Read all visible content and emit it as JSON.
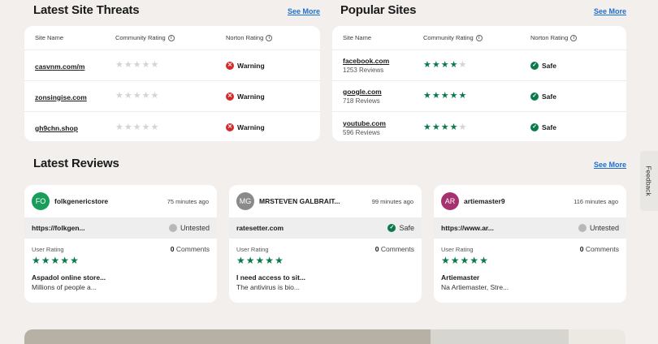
{
  "threats": {
    "title": "Latest Site Threats",
    "see_more": "See More",
    "headers": {
      "site": "Site Name",
      "community": "Community Rating",
      "norton": "Norton Rating"
    },
    "rows": [
      {
        "site": "casvnm.com/m",
        "stars": 0,
        "status": "Warning"
      },
      {
        "site": "zonsingise.com",
        "stars": 0,
        "status": "Warning"
      },
      {
        "site": "gh9chn.shop",
        "stars": 0,
        "status": "Warning"
      }
    ]
  },
  "popular": {
    "title": "Popular Sites",
    "see_more": "See More",
    "headers": {
      "site": "Site Name",
      "community": "Community Rating",
      "norton": "Norton Rating"
    },
    "rows": [
      {
        "site": "facebook.com",
        "reviews": "1253 Reviews",
        "stars": 4,
        "status": "Safe"
      },
      {
        "site": "google.com",
        "reviews": "718 Reviews",
        "stars": 5,
        "status": "Safe"
      },
      {
        "site": "youtube.com",
        "reviews": "596 Reviews",
        "stars": 4,
        "status": "Safe"
      }
    ]
  },
  "reviews": {
    "title": "Latest Reviews",
    "see_more": "See More",
    "user_rating_label": "User Rating",
    "comments_label": "Comments",
    "cards": [
      {
        "initials": "FO",
        "avatar_color": "#1a9d5a",
        "user": "folkgenericstore",
        "time": "75 minutes ago",
        "site": "https://folkgen...",
        "status": "Untested",
        "stars": 5,
        "comments": "0",
        "title": "Aspadol online store...",
        "text": "Millions of people a..."
      },
      {
        "initials": "MG",
        "avatar_color": "#8a8a8a",
        "user": "MRSTEVEN GALBRAIT...",
        "time": "99 minutes ago",
        "site": "ratesetter.com",
        "status": "Safe",
        "stars": 5,
        "comments": "0",
        "title": "I need access to sit...",
        "text": "The antivirus is bio..."
      },
      {
        "initials": "AR",
        "avatar_color": "#a5326f",
        "user": "artiemaster9",
        "time": "116 minutes ago",
        "site": "https://www.ar...",
        "status": "Untested",
        "stars": 5,
        "comments": "0",
        "title": "Artiemaster",
        "text": "Na Artiemaster, Stre..."
      }
    ]
  },
  "feedback": "Feedback",
  "colors": {
    "accent": "#1d6fd1",
    "safe": "#0b7a4b",
    "warning": "#d32b2b",
    "untested": "#b8b8b8"
  }
}
